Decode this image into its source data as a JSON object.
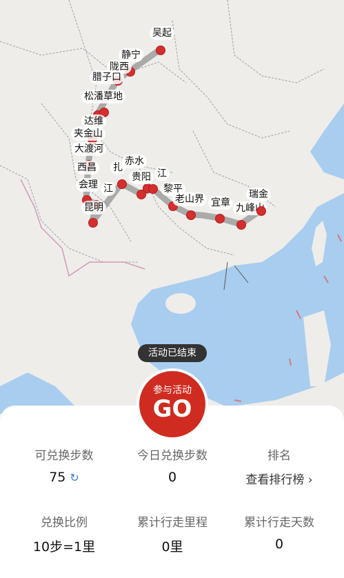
{
  "map": {
    "places": [
      {
        "name": "吴起"
      },
      {
        "name": "静宁"
      },
      {
        "name": "陇西"
      },
      {
        "name": "腊子口"
      },
      {
        "name": "松潘草地"
      },
      {
        "name": "达维"
      },
      {
        "name": "夹金山"
      },
      {
        "name": "大渡河"
      },
      {
        "name": "西昌"
      },
      {
        "name": "会理"
      },
      {
        "name": "江"
      },
      {
        "name": "昆明"
      },
      {
        "name": "扎"
      },
      {
        "name": "赤水"
      },
      {
        "name": "贵阳"
      },
      {
        "name": "江"
      },
      {
        "name": "黎平"
      },
      {
        "name": "老山界"
      },
      {
        "name": "宜章"
      },
      {
        "name": "九峰山"
      },
      {
        "name": "瑞金"
      }
    ],
    "route_color": "#9e9e9e",
    "marker_color": "#d32f2f"
  },
  "status_badge": "活动已结束",
  "go_button": {
    "line1": "参与活动",
    "line2": "GO"
  },
  "stats": {
    "exchangeable_steps": {
      "label": "可兑换步数",
      "value": "75"
    },
    "today_exchanged": {
      "label": "今日兑换步数",
      "value": "0"
    },
    "rank": {
      "label": "排名",
      "value": "查看排行榜 ›"
    },
    "ratio": {
      "label": "兑换比例",
      "value": "10步=1里"
    },
    "total_distance": {
      "label": "累计行走里程",
      "value": "0里"
    },
    "total_days": {
      "label": "累计行走天数",
      "value": "0"
    }
  },
  "icons": {
    "refresh": "refresh-icon"
  }
}
